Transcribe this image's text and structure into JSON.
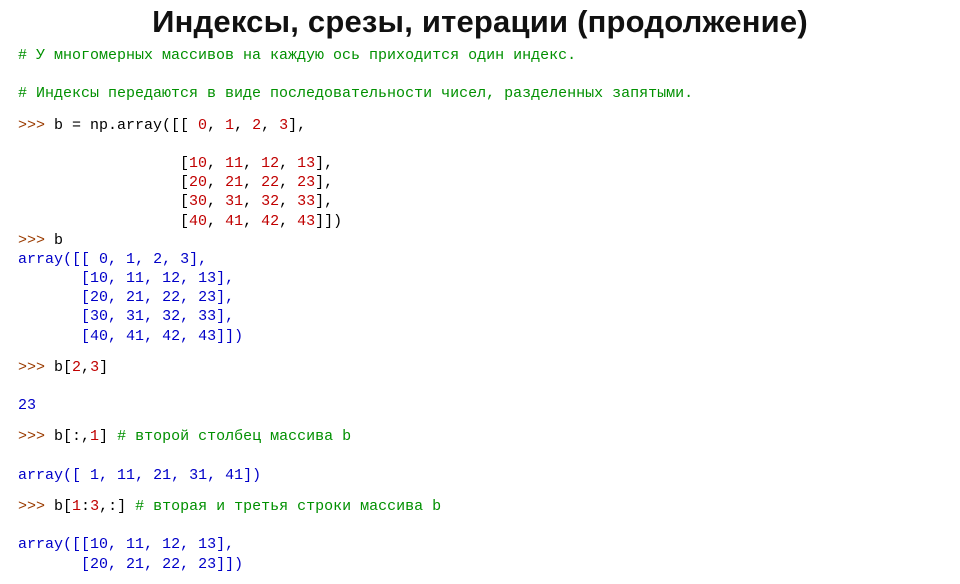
{
  "title": "Индексы, срезы, итерации (продолжение)",
  "comment1": "# У многомерных массивов на каждую ось приходится один индекс.",
  "comment2": "# Индексы передаются в виде последовательности чисел, разделенных запятыми.",
  "prompt": ">>>",
  "code": {
    "def_prefix": " b = np.array([[ ",
    "row0": {
      "v0": "0",
      "v1": "1",
      "v2": "2",
      "v3": "3"
    },
    "row_prefix": "                  [",
    "row1": {
      "v0": "10",
      "v1": "11",
      "v2": "12",
      "v3": "13"
    },
    "row2": {
      "v0": "20",
      "v1": "21",
      "v2": "22",
      "v3": "23"
    },
    "row3": {
      "v0": "30",
      "v1": "31",
      "v2": "32",
      "v3": "33"
    },
    "row4": {
      "v0": "40",
      "v1": "41",
      "v2": "42",
      "v3": "43"
    },
    "show_b": " b",
    "out_prefix": "array([[ ",
    "out_row_prefix": "       [",
    "idx23": " b[",
    "idx23_a": "2",
    "idx23_b": "3",
    "idx23_out": "23",
    "col1": " b[:,",
    "col1_idx": "1",
    "col1_comment": " # второй столбец массива b",
    "col1_out_pre": "array([ ",
    "col1_out": {
      "v0": "1",
      "v1": "11",
      "v2": "21",
      "v3": "31",
      "v4": "41"
    },
    "rows13": " b[",
    "rows13_a": "1",
    "rows13_b": "3",
    "rows13_suffix": ",:]",
    "rows13_comment": " # вторая и третья строки массива b",
    "rows13_out_pre": "array([[",
    "rows13_out_pre2": "       ["
  }
}
